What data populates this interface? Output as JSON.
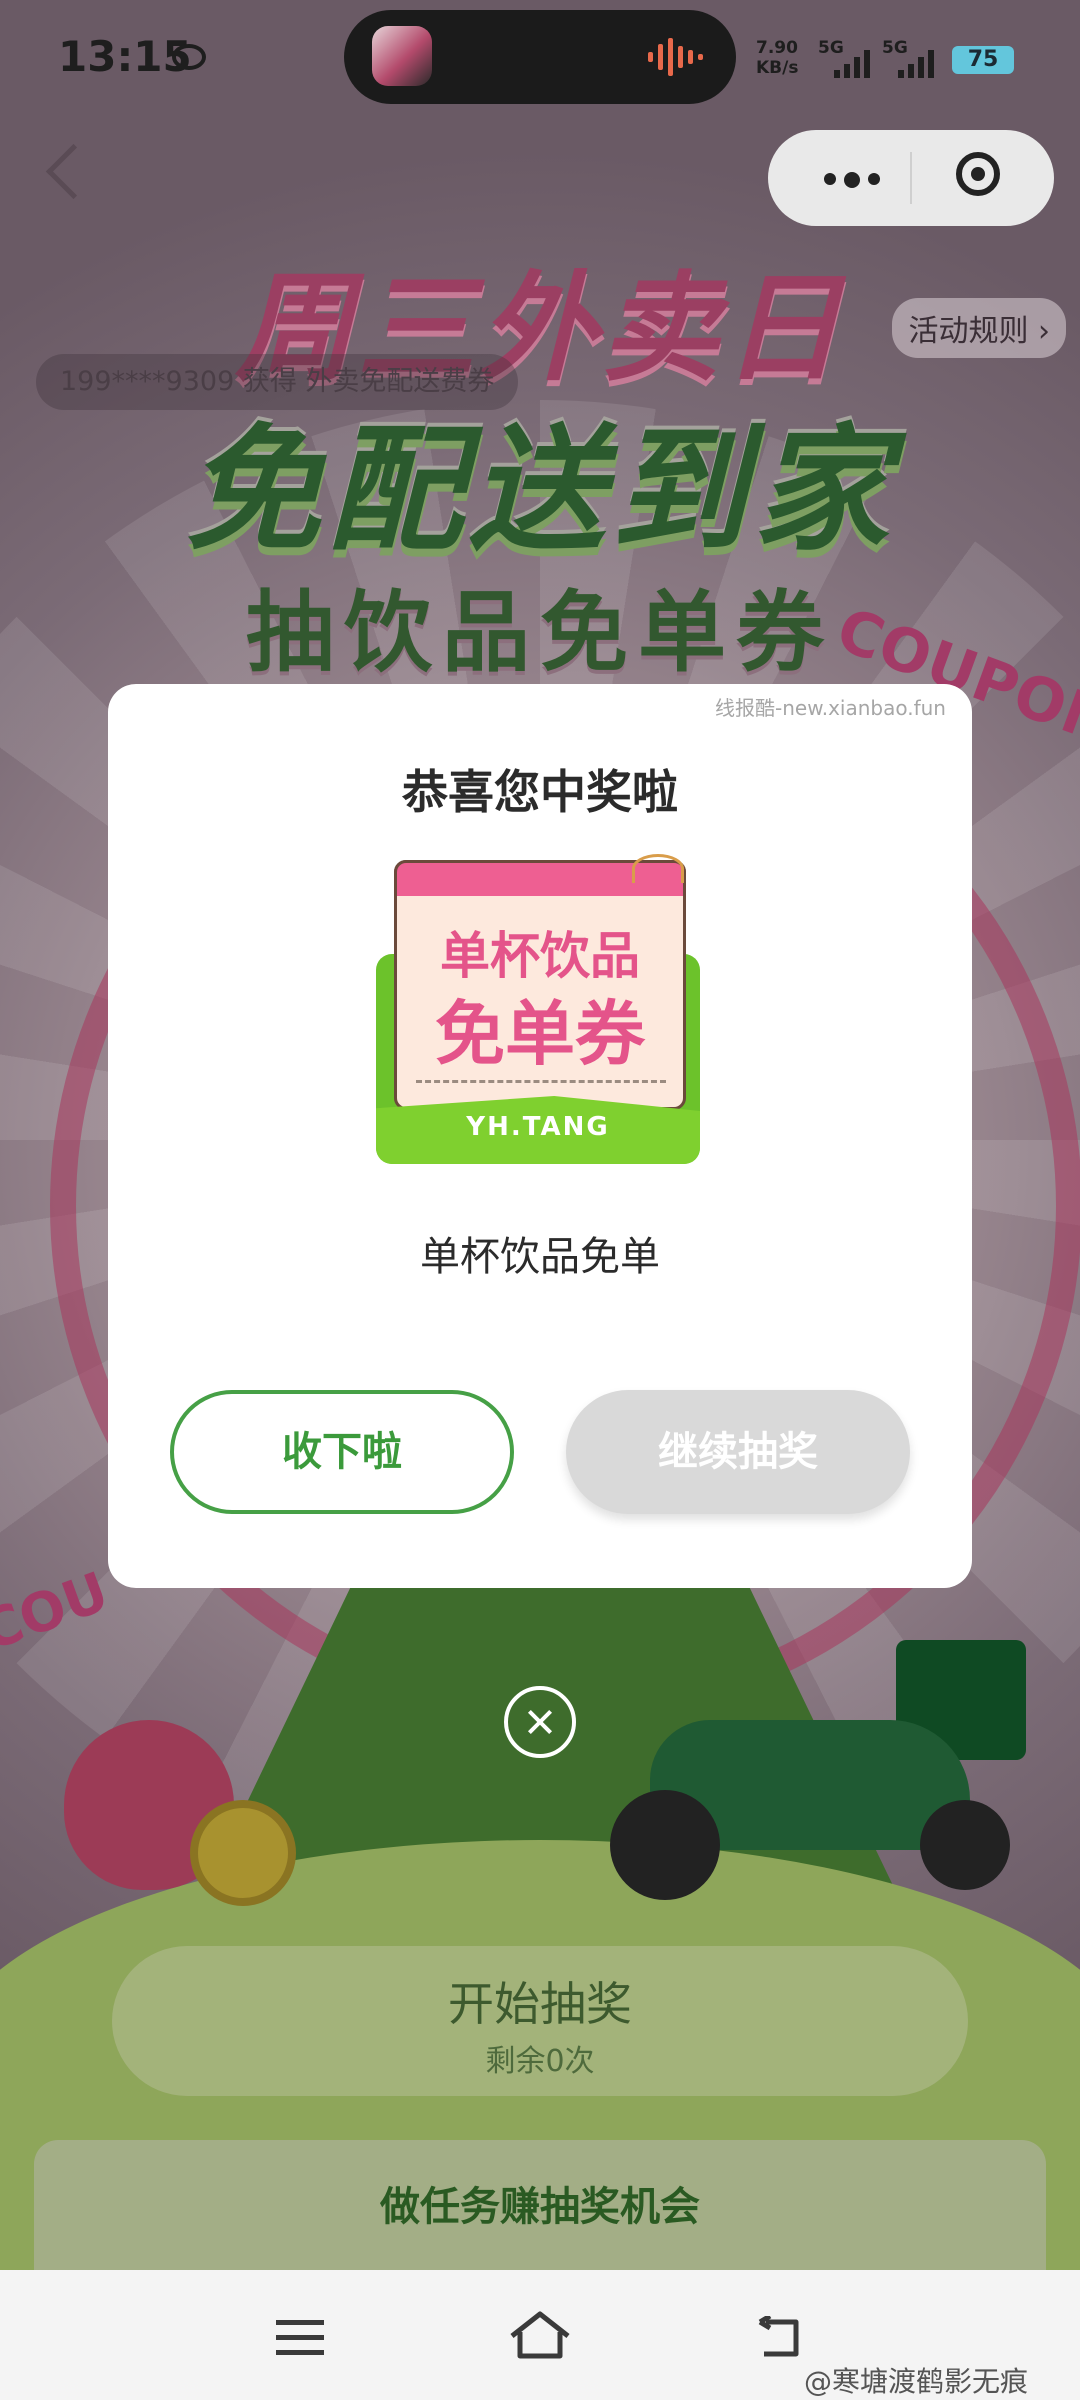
{
  "status_bar": {
    "time": "13:15",
    "net_speed_value": "7.90",
    "net_speed_unit": "KB/s",
    "sim1": "5G",
    "sim2": "5G",
    "battery": "75"
  },
  "nav": {
    "rules_label": "活动规则 ›"
  },
  "ticker": {
    "text": "199****9309 获得 外卖免配送费券"
  },
  "hero": {
    "line1": "周三外卖日",
    "line2": "免配送到家",
    "line3": "抽饮品免单券",
    "coupon_word": "COUPON",
    "coupon_word2": "COU"
  },
  "modal": {
    "watermark": "线报酷-new.xianbao.fun",
    "title": "恭喜您中奖啦",
    "ticket_line1": "单杯饮品",
    "ticket_line2": "免单券",
    "ticket_brand": "YH.TANG",
    "prize_name": "单杯饮品免单",
    "accept_label": "收下啦",
    "continue_label": "继续抽奖"
  },
  "draw": {
    "label": "开始抽奖",
    "remaining": "剩余0次"
  },
  "task": {
    "title": "做任务赚抽奖机会"
  },
  "footer": {
    "handle": "@寒塘渡鹤影无痕"
  }
}
